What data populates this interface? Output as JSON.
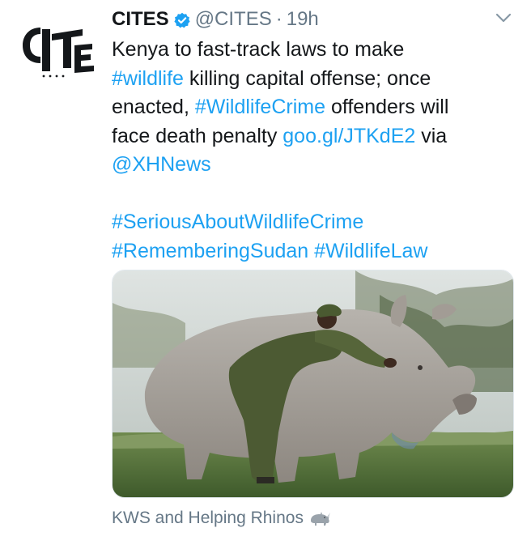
{
  "tweet": {
    "author_name": "CITES",
    "author_handle": "@CITES",
    "separator": "·",
    "time": "19h",
    "avatar_icon": "cites-logo-icon",
    "verified_icon": "verified-badge-icon",
    "menu_icon": "chevron-down-icon",
    "text": {
      "l1": "Kenya to fast-track laws to make",
      "l2_tag": "#wildlife",
      "l2_rest": " killing capital offense; once",
      "l3_start": "enacted, ",
      "l3_tag": "#WildlifeCrime",
      "l3_rest": " offenders will",
      "l4_start": "face death penalty ",
      "l4_link": "goo.gl/JTKdE2",
      "l4_rest": " via",
      "l5_mention": "@XHNews",
      "l6_tag": "#SeriousAboutWildlifeCrime",
      "l7_tag1": "#RememberingSudan",
      "l7_space": " ",
      "l7_tag2": "#WildlifeLaw"
    },
    "media_credit": "KWS and Helping Rhinos",
    "media_credit_icon": "rhino-emoji-icon"
  },
  "colors": {
    "link": "#1da1f2",
    "text": "#14171a",
    "muted": "#657786",
    "verified": "#1da1f2"
  }
}
